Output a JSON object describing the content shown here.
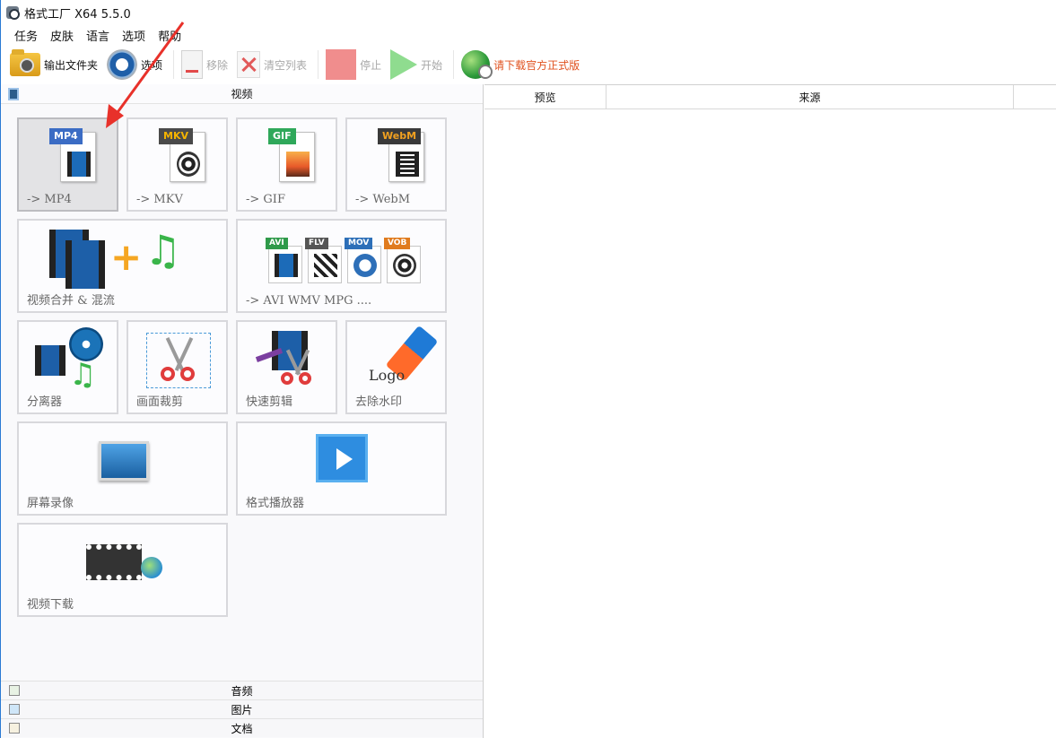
{
  "window": {
    "title": "格式工厂 X64 5.5.0"
  },
  "menu": [
    "任务",
    "皮肤",
    "语言",
    "选项",
    "帮助"
  ],
  "toolbar": {
    "output_folder": "输出文件夹",
    "options": "选项",
    "remove": "移除",
    "clear_list": "清空列表",
    "stop": "停止",
    "start": "开始",
    "download": "请下载官方正式版"
  },
  "categories": {
    "video": "视频",
    "audio": "音频",
    "image": "图片",
    "document": "文档"
  },
  "video_tiles": [
    {
      "label": "-> MP4",
      "tag": "MP4",
      "tag_color": "#3b6cc4"
    },
    {
      "label": "-> MKV",
      "tag": "MKV",
      "tag_color": "#4a4a4a"
    },
    {
      "label": "-> GIF",
      "tag": "GIF",
      "tag_color": "#2fa85a"
    },
    {
      "label": "-> WebM",
      "tag": "WebM",
      "tag_color": "#e08a1e"
    },
    {
      "label": "视频合并 & 混流"
    },
    {
      "label": "-> AVI WMV MPG ....",
      "formats": [
        "AVI",
        "FLV",
        "MOV",
        "VOB"
      ]
    },
    {
      "label": "分离器"
    },
    {
      "label": "画面裁剪"
    },
    {
      "label": "快速剪辑"
    },
    {
      "label": "去除水印",
      "logo_text": "Logo"
    },
    {
      "label": "屏幕录像"
    },
    {
      "label": "格式播放器"
    },
    {
      "label": "视频下载"
    }
  ],
  "list_header": {
    "preview": "预览",
    "source": "来源"
  },
  "colors": {
    "accent": "#2b7ad4",
    "annotation_arrow": "#e8312a",
    "download_link": "#e0521f"
  }
}
